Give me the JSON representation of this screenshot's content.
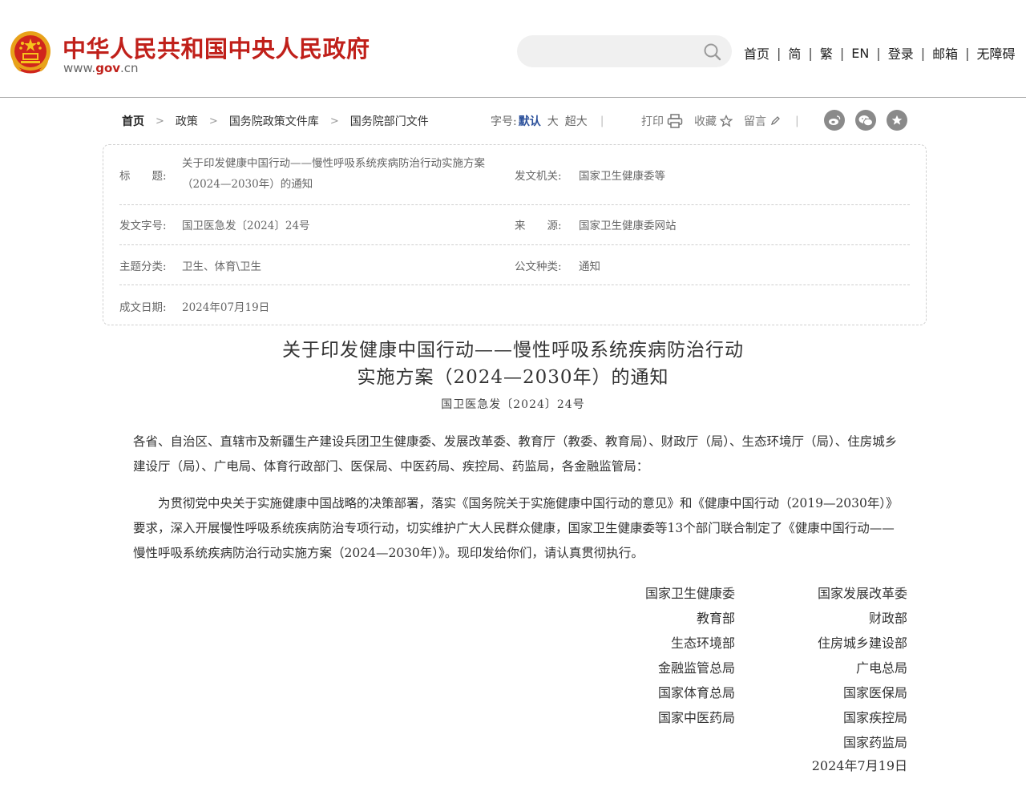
{
  "header": {
    "site_title": "中华人民共和国中央人民政府",
    "site_url_pre": "www.",
    "site_url_mid": "gov",
    "site_url_post": ".cn",
    "search_placeholder": "",
    "nav": [
      "首页",
      "简",
      "繁",
      "EN",
      "登录",
      "邮箱",
      "无障碍"
    ],
    "nav_sep": "|"
  },
  "breadcrumb": [
    "首页",
    "政策",
    "国务院政策文件库",
    "国务院部门文件"
  ],
  "breadcrumb_sep": ">",
  "fontsize": {
    "label": "字号:",
    "options": [
      "默认",
      "大",
      "超大"
    ],
    "active": "默认"
  },
  "actions": {
    "print": "打印",
    "collect": "收藏",
    "comment": "留言"
  },
  "share_icons": [
    "weibo-icon",
    "wechat-icon",
    "favorite-star-icon"
  ],
  "meta": {
    "title_label": "标　　题:",
    "title_line1": "关于印发健康中国行动——慢性呼吸系统疾病防治行动实施方案",
    "title_line2": "（2024—2030年）的通知",
    "issuer_label": "发文机关:",
    "issuer": "国家卫生健康委等",
    "docno_label": "发文字号:",
    "docno": "国卫医急发〔2024〕24号",
    "source_label": "来　　源:",
    "source": "国家卫生健康委网站",
    "topic_label": "主题分类:",
    "topic": "卫生、体育\\卫生",
    "doctype_label": "公文种类:",
    "doctype": "通知",
    "date_label": "成文日期:",
    "date": "2024年07月19日"
  },
  "article": {
    "title_line1": "关于印发健康中国行动——慢性呼吸系统疾病防治行动",
    "title_line2": "实施方案（2024—2030年）的通知",
    "doc_no": "国卫医急发〔2024〕24号",
    "recipients": "各省、自治区、直辖市及新疆生产建设兵团卫生健康委、发展改革委、教育厅（教委、教育局）、财政厅（局）、生态环境厅（局）、住房城乡建设厅（局）、广电局、体育行政部门、医保局、中医药局、疾控局、药监局，各金融监管局：",
    "body": "为贯彻党中央关于实施健康中国战略的决策部署，落实《国务院关于实施健康中国行动的意见》和《健康中国行动（2019—2030年）》要求，深入开展慢性呼吸系统疾病防治专项行动，切实维护广大人民群众健康，国家卫生健康委等13个部门联合制定了《健康中国行动——慢性呼吸系统疾病防治行动实施方案（2024—2030年）》。现印发给你们，请认真贯彻执行。",
    "signers_left": [
      "国家卫生健康委",
      "教育部",
      "生态环境部",
      "金融监管总局",
      "国家体育总局",
      "国家中医药局"
    ],
    "signers_right": [
      "国家发展改革委",
      "财政部",
      "住房城乡建设部",
      "广电总局",
      "国家医保局",
      "国家疾控局",
      "国家药监局"
    ],
    "sign_date": "2024年7月19日"
  }
}
